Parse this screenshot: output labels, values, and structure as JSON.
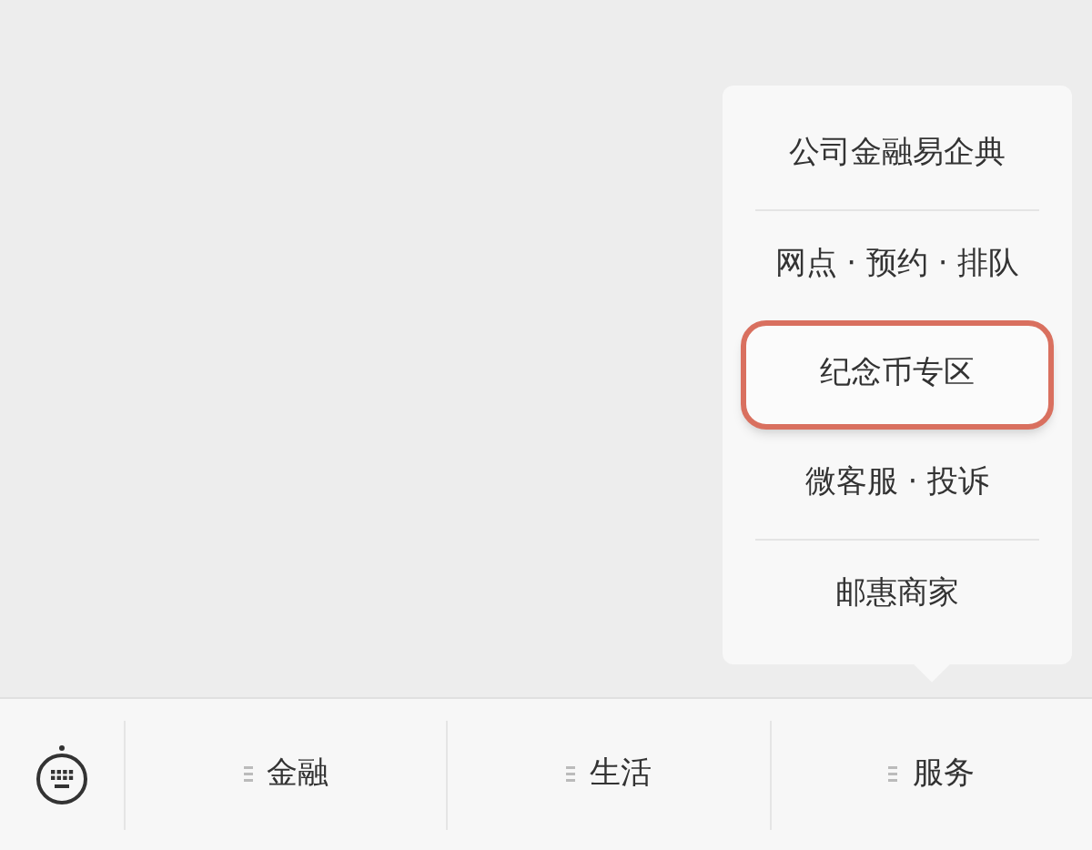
{
  "menu": {
    "items": [
      {
        "label": "公司金融易企典",
        "highlighted": false
      },
      {
        "label": "网点 · 预约 · 排队",
        "highlighted": false
      },
      {
        "label": "纪念币专区",
        "highlighted": true
      },
      {
        "label": "微客服 · 投诉",
        "highlighted": false
      },
      {
        "label": "邮惠商家",
        "highlighted": false
      }
    ]
  },
  "bottom_bar": {
    "tabs": [
      {
        "label": "金融"
      },
      {
        "label": "生活"
      },
      {
        "label": "服务"
      }
    ]
  }
}
